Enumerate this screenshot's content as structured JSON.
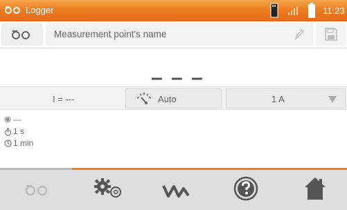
{
  "header": {
    "title": "Logger",
    "clock": "11:23"
  },
  "measurement_point": {
    "placeholder": "Measurement point's name"
  },
  "reading": {
    "value": "– – –"
  },
  "parameters": {
    "current": "I = ---",
    "range_mode": "Auto",
    "range": "1 A"
  },
  "settings": {
    "status": "---",
    "interval": "1 s",
    "duration": "1 min"
  },
  "colors": {
    "accent": "#ee7e22",
    "icon_dark": "#555555"
  },
  "icons": {
    "logger": "tape-reel-icon",
    "save": "floppy-disk-icon",
    "edit": "pencil-icon",
    "range": "gauge-needle-icon",
    "settings": "gears-icon",
    "graph": "waveform-icon",
    "help": "question-icon",
    "home": "home-icon"
  }
}
